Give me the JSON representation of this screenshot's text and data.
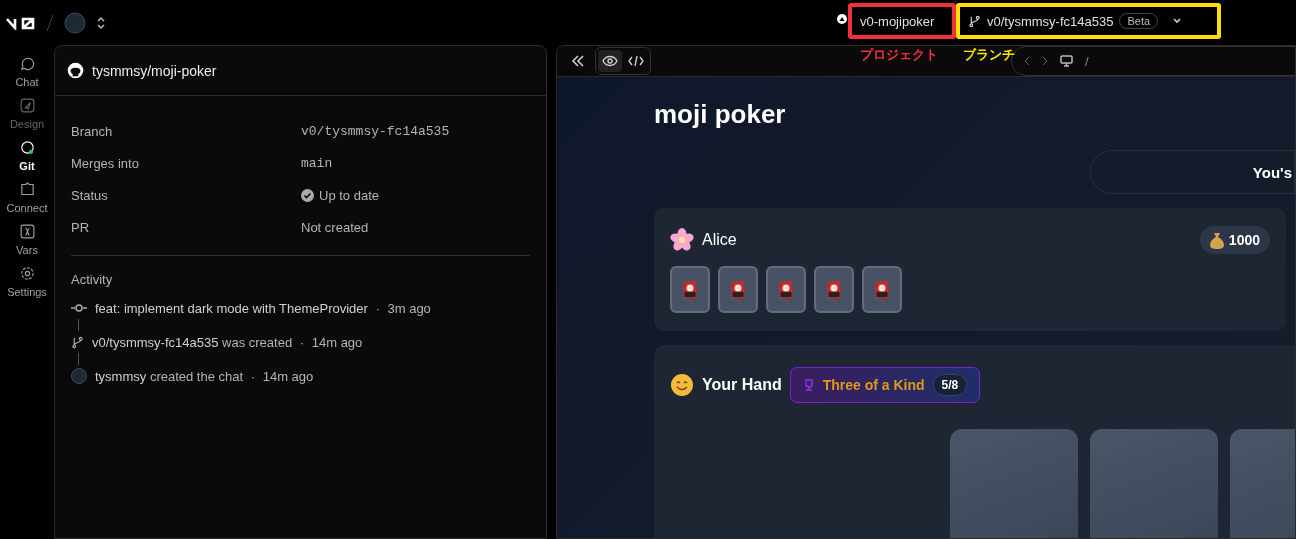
{
  "topbar": {
    "project": "v0-mojipoker",
    "branch": "v0/tysmmsy-fc14a535",
    "branch_badge": "Beta"
  },
  "annotations": [
    {
      "label": "プロジェクト",
      "color": "#f0303f"
    },
    {
      "label": "ブランチ",
      "color": "#ffe000"
    }
  ],
  "sidebar": {
    "items": [
      {
        "label": "Chat",
        "kind": "chat",
        "selected": false,
        "disabled": false
      },
      {
        "label": "Design",
        "kind": "design",
        "selected": false,
        "disabled": true
      },
      {
        "label": "Git",
        "kind": "git",
        "selected": true,
        "disabled": false
      },
      {
        "label": "Connect",
        "kind": "connect",
        "selected": false,
        "disabled": false
      },
      {
        "label": "Vars",
        "kind": "vars",
        "selected": false,
        "disabled": false
      },
      {
        "label": "Settings",
        "kind": "settings",
        "selected": false,
        "disabled": false
      }
    ]
  },
  "git_panel": {
    "repo": "tysmmsy/moji-poker",
    "fields": [
      {
        "label": "Branch",
        "value": "v0/tysmmsy-fc14a535",
        "kind": "mono"
      },
      {
        "label": "Merges into",
        "value": "main",
        "kind": "mono"
      },
      {
        "label": "Status",
        "value": "Up to date",
        "kind": "status"
      },
      {
        "label": "PR",
        "value": "Not created",
        "kind": "text"
      }
    ],
    "activity_title": "Activity",
    "activity": [
      {
        "kind": "commit",
        "subject": "feat: implement dark mode with ThemeProvider",
        "separator": "·",
        "time": "3m ago"
      },
      {
        "kind": "branch",
        "subject": "v0/tysmmsy-fc14a535",
        "action": "was created",
        "separator": "·",
        "time": "14m ago"
      },
      {
        "kind": "user",
        "subject": "tysmmsy",
        "action": "created the chat",
        "separator": "·",
        "time": "14m ago"
      }
    ]
  },
  "preview": {
    "view_tabs": [
      {
        "kind": "preview",
        "selected": true
      },
      {
        "kind": "code",
        "selected": false
      }
    ],
    "path": "/",
    "app": {
      "title": "moji poker",
      "banner": "You's",
      "opponent": {
        "name": "Alice",
        "chips": "1000"
      },
      "hand": {
        "title": "Your Hand",
        "rank": "Three of a Kind",
        "score": "5/8"
      }
    }
  }
}
